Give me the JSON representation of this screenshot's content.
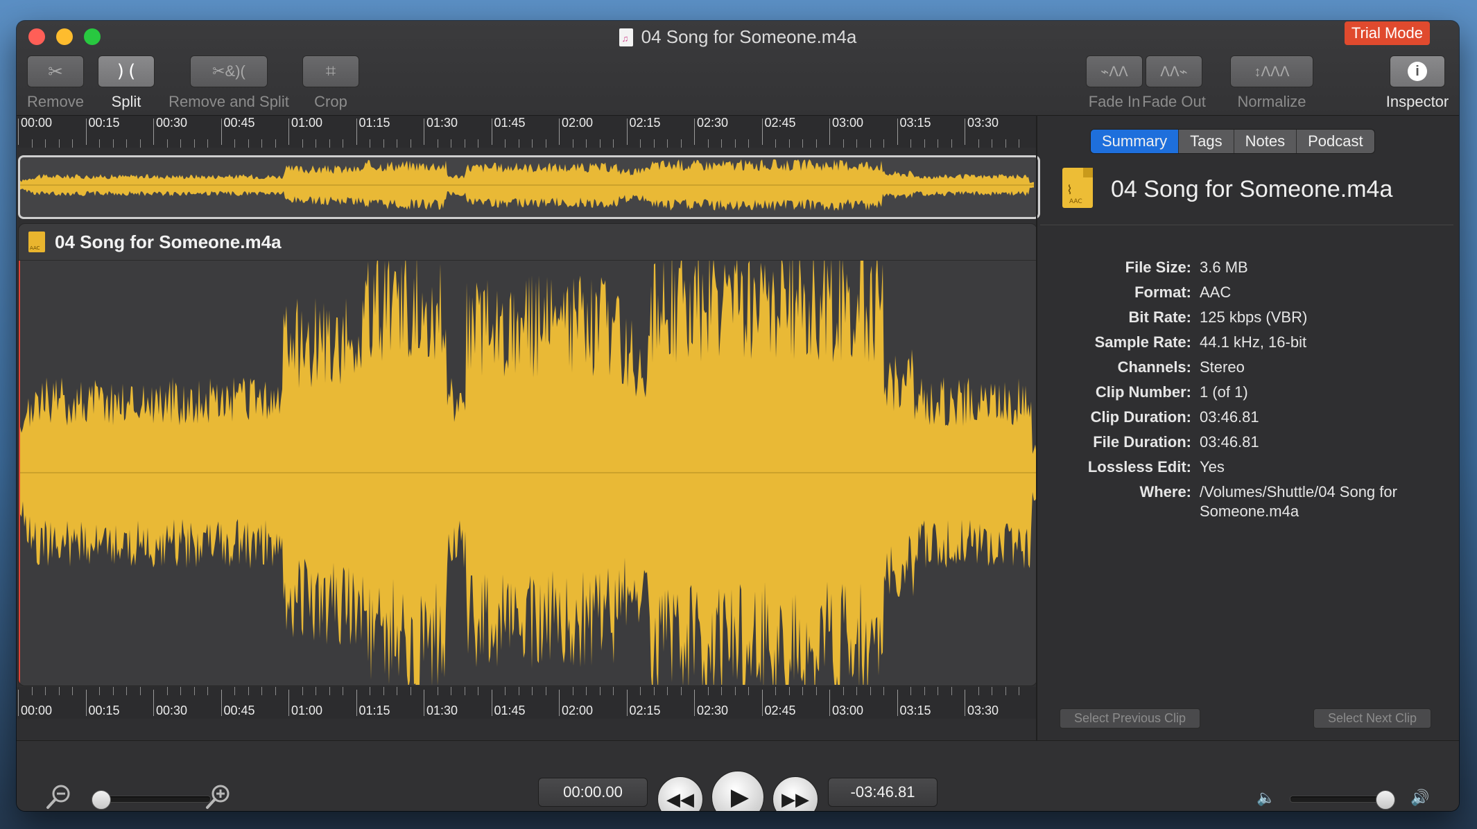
{
  "window": {
    "title": "04 Song for Someone.m4a",
    "trial_badge": "Trial Mode"
  },
  "toolbar": {
    "remove": "Remove",
    "split": "Split",
    "remove_and_split": "Remove and Split",
    "crop": "Crop",
    "fade_in": "Fade In",
    "fade_out": "Fade Out",
    "normalize": "Normalize",
    "inspector": "Inspector"
  },
  "timeline": {
    "labels": [
      "00:00",
      "00:15",
      "00:30",
      "00:45",
      "01:00",
      "01:15",
      "01:30",
      "01:45",
      "02:00",
      "02:15",
      "02:30",
      "02:45",
      "03:00",
      "03:15",
      "03:30"
    ]
  },
  "clip": {
    "title": "04 Song for Someone.m4a",
    "waveform_color": "#e9b936"
  },
  "inspector": {
    "tabs": [
      "Summary",
      "Tags",
      "Notes",
      "Podcast"
    ],
    "selected_tab": "Summary",
    "file_title": "04 Song for Someone.m4a",
    "fields": [
      {
        "key": "File Size:",
        "value": "3.6 MB"
      },
      {
        "key": "Format:",
        "value": "AAC"
      },
      {
        "key": "Bit Rate:",
        "value": "125 kbps (VBR)"
      },
      {
        "key": "Sample Rate:",
        "value": "44.1 kHz, 16-bit"
      },
      {
        "key": "Channels:",
        "value": "Stereo"
      },
      {
        "key": "Clip Number:",
        "value": "1 (of 1)"
      },
      {
        "key": "Clip Duration:",
        "value": "03:46.81"
      },
      {
        "key": "File Duration:",
        "value": "03:46.81"
      },
      {
        "key": "Lossless Edit:",
        "value": "Yes"
      },
      {
        "key": "Where:",
        "value": "/Volumes/Shuttle/04 Song for Someone.m4a"
      }
    ],
    "prev_clip": "Select Previous Clip",
    "next_clip": "Select Next Clip"
  },
  "transport": {
    "elapsed": "00:00.00",
    "remaining": "-03:46.81",
    "zoom_level": 0.0,
    "volume_level": 1.0
  },
  "colors": {
    "accent": "#1e6fdc",
    "trial": "#e04a2e",
    "waveform": "#e9b936"
  }
}
